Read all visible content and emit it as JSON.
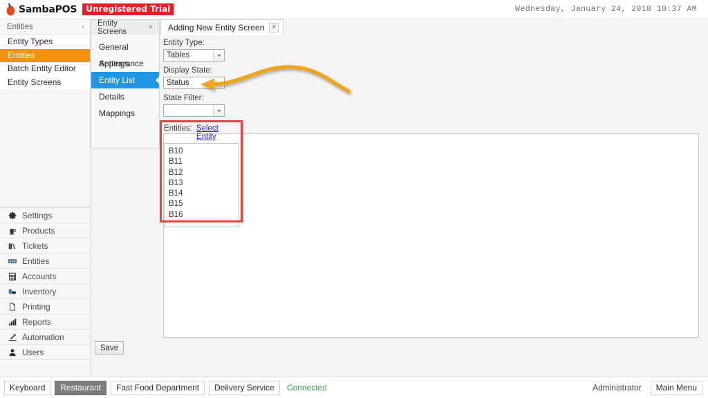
{
  "titlebar": {
    "brand": "SambaPOS",
    "trial_badge": "Unregistered Trial",
    "clock": "Wednesday, January 24, 2018 10:37 AM",
    "logo_icon": "pepper-logo-icon"
  },
  "sidebar": {
    "header": "Entities",
    "collapse_icon": "‹",
    "items": [
      {
        "label": "Entity Types",
        "active": false
      },
      {
        "label": "Entities",
        "active": true
      },
      {
        "label": "Batch Entity Editor",
        "active": false
      },
      {
        "label": "Entity Screens",
        "active": false
      }
    ],
    "nav": [
      {
        "label": "Settings",
        "icon": "gear-icon"
      },
      {
        "label": "Products",
        "icon": "cup-icon"
      },
      {
        "label": "Tickets",
        "icon": "tickets-icon"
      },
      {
        "label": "Entities",
        "icon": "table-icon"
      },
      {
        "label": "Accounts",
        "icon": "calculator-icon"
      },
      {
        "label": "Inventory",
        "icon": "boxes-icon"
      },
      {
        "label": "Printing",
        "icon": "page-icon"
      },
      {
        "label": "Reports",
        "icon": "bar-chart-icon"
      },
      {
        "label": "Automation",
        "icon": "pencil-icon"
      },
      {
        "label": "Users",
        "icon": "user-icon"
      }
    ]
  },
  "middle": {
    "tab_label": "Entity Screens",
    "tab_close_icon": "×",
    "items": [
      {
        "label": "General Settings",
        "active": false
      },
      {
        "label": "Appearance",
        "active": false
      },
      {
        "label": "Entity List",
        "active": true
      },
      {
        "label": "Details",
        "active": false
      },
      {
        "label": "Mappings",
        "active": false
      }
    ]
  },
  "main": {
    "document_tab": "Adding New Entity Screen",
    "document_tab_close_icon": "×",
    "fields": {
      "entity_type_label": "Entity Type:",
      "entity_type_value": "Tables",
      "display_state_label": "Display State:",
      "display_state_value": "Status",
      "state_filter_label": "State Filter:",
      "state_filter_value": ""
    },
    "entities": {
      "label": "Entities:",
      "select_link": "Select Entity",
      "rows": [
        "B10",
        "B11",
        "B12",
        "B13",
        "B14",
        "B15",
        "B16"
      ]
    },
    "save_label": "Save"
  },
  "annotations": {
    "arrow_color": "#f0a51e",
    "highlight_box_color": "#ef3e3e"
  },
  "statusbar": {
    "buttons": [
      {
        "label": "Keyboard",
        "selected": false
      },
      {
        "label": "Restaurant",
        "selected": true
      },
      {
        "label": "Fast Food Department",
        "selected": false
      },
      {
        "label": "Delivery Service",
        "selected": false
      }
    ],
    "connection_status": "Connected",
    "user": "Administrator",
    "main_menu_label": "Main Menu"
  }
}
